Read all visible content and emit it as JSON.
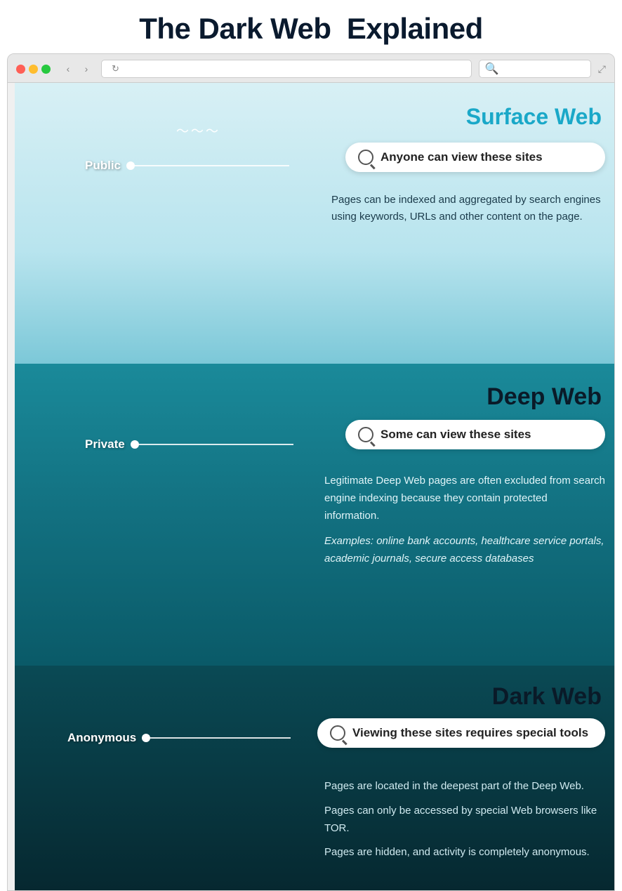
{
  "title": {
    "part1": "The Dark Web",
    "part2": "Explained"
  },
  "browser": {
    "address_placeholder": "",
    "search_placeholder": "",
    "reload": "↻",
    "back": "‹",
    "forward": "›",
    "expand": "⤢"
  },
  "surface": {
    "label": "Surface Web",
    "area_label": "Public",
    "search_text": "Anyone can view these sites",
    "description": "Pages can be indexed and aggregated by search engines using keywords, URLs and other content on the page."
  },
  "deep": {
    "label": "Deep Web",
    "area_label": "Private",
    "search_text": "Some can view these sites",
    "description": "Legitimate Deep Web pages are often excluded from search engine indexing because they contain protected information.",
    "examples": "Examples: online bank accounts, healthcare service portals, academic journals, secure access databases"
  },
  "dark": {
    "label": "Dark Web",
    "area_label": "Anonymous",
    "search_text": "Viewing these sites requires special tools",
    "bullet1": "Pages are located in the deepest part of the Deep Web.",
    "bullet2": "Pages can only be accessed by special Web browsers like TOR.",
    "bullet3": "Pages are hidden, and activity is completely anonymous."
  }
}
